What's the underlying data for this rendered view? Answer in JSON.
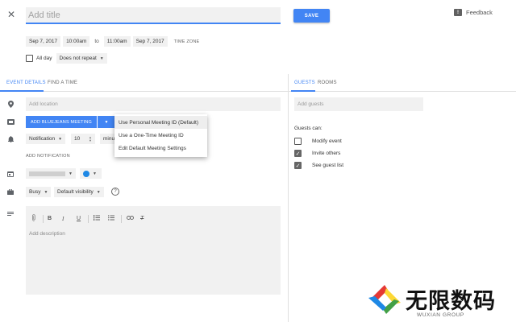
{
  "header": {
    "title_placeholder": "Add title",
    "save_label": "SAVE",
    "feedback_label": "Feedback"
  },
  "datetime": {
    "start_date": "Sep 7, 2017",
    "start_time": "10:00am",
    "to_label": "to",
    "end_time": "11:00am",
    "end_date": "Sep 7, 2017",
    "timezone_label": "TIME ZONE",
    "all_day_label": "All day",
    "repeat_value": "Does not repeat"
  },
  "tabs": {
    "event_details": "EVENT DETAILS",
    "find_time": "FIND A TIME",
    "guests": "GUESTS",
    "rooms": "ROOMS"
  },
  "location": {
    "placeholder": "Add location"
  },
  "conference": {
    "button_label": "ADD BLUEJEANS MEETING",
    "menu": [
      "Use Personal Meeting ID (Default)",
      "Use a One-Time Meeting ID",
      "Edit Default Meeting Settings"
    ]
  },
  "notification": {
    "type": "Notification",
    "amount": "10",
    "unit": "minu",
    "add_label": "ADD NOTIFICATION"
  },
  "calendar": {
    "color": "#1e88e5"
  },
  "availability": {
    "status": "Busy",
    "visibility": "Default visibility"
  },
  "description": {
    "placeholder": "Add description",
    "toolbar_icons": [
      "attachment-icon",
      "bold-icon",
      "italic-icon",
      "underline-icon",
      "numbered-list-icon",
      "bulleted-list-icon",
      "link-icon",
      "clear-format-icon"
    ]
  },
  "guests": {
    "placeholder": "Add guests",
    "can_label": "Guests can:",
    "permissions": [
      {
        "label": "Modify event",
        "checked": false
      },
      {
        "label": "Invite others",
        "checked": true
      },
      {
        "label": "See guest list",
        "checked": true
      }
    ]
  },
  "watermark": {
    "brand": "无限数码",
    "sub": "WUXIAN GROUP"
  }
}
